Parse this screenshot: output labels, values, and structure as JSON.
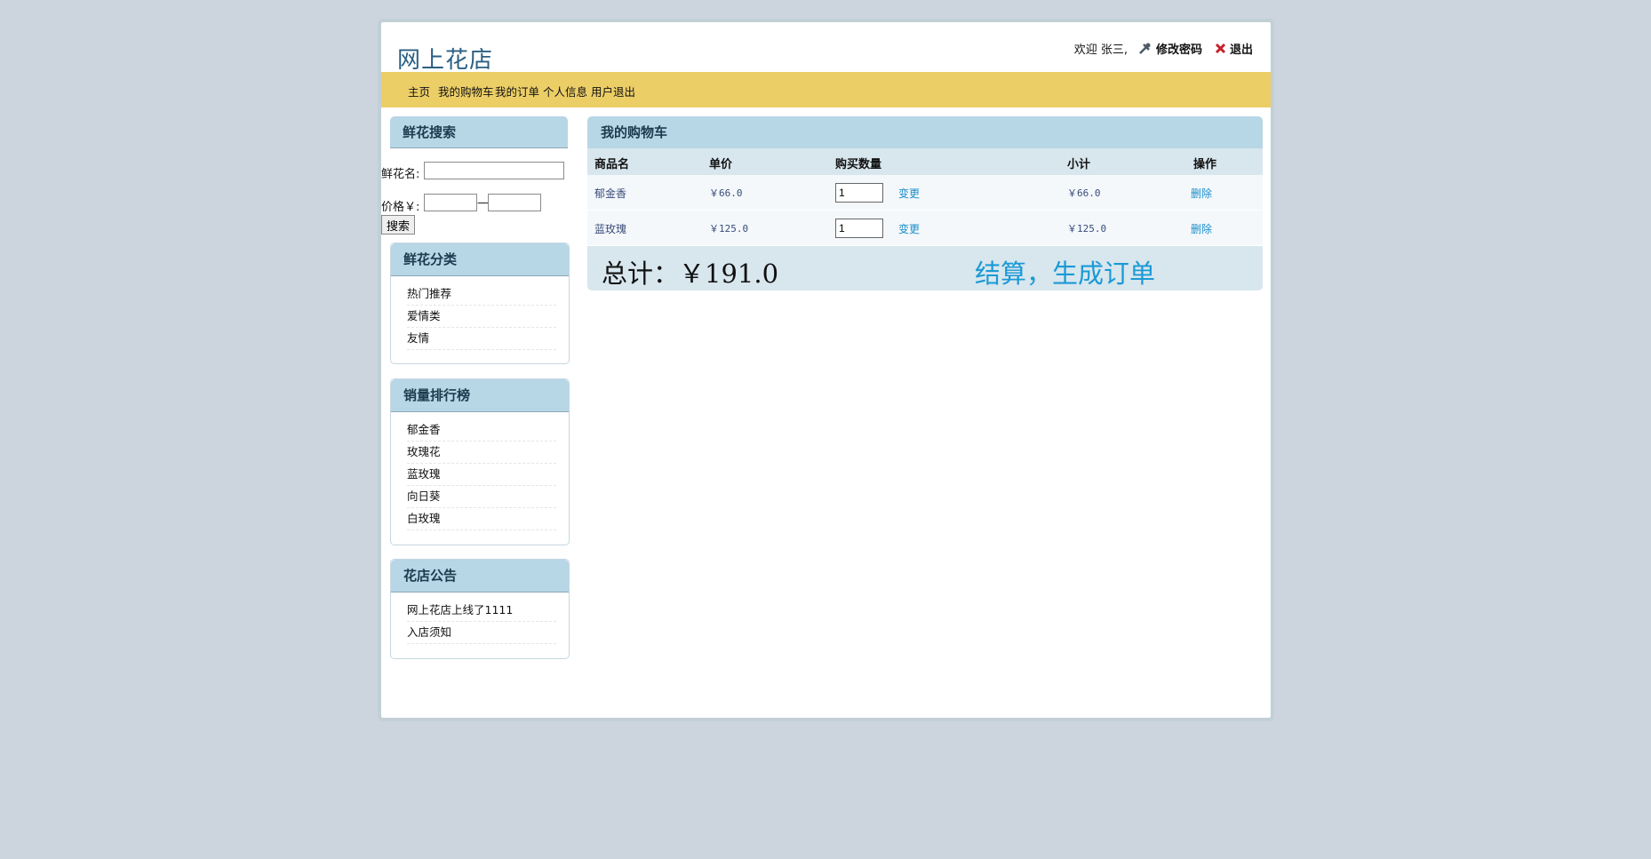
{
  "site": {
    "title": "网上花店"
  },
  "header": {
    "welcome": "欢迎 张三,",
    "change_password": "修改密码",
    "logout": "退出"
  },
  "nav": [
    "主页",
    "我的购物车",
    "我的订单",
    "个人信息",
    "用户退出"
  ],
  "search": {
    "title": "鲜花搜索",
    "name_label": "鲜花名:",
    "price_label": "价格￥:",
    "range_sep": "—",
    "button": "搜索",
    "name_value": "",
    "price_min_value": "",
    "price_max_value": ""
  },
  "categories": {
    "title": "鲜花分类",
    "items": [
      "热门推荐",
      "爱情类",
      "友情"
    ]
  },
  "ranking": {
    "title": "销量排行榜",
    "items": [
      "郁金香",
      "玫瑰花",
      "蓝玫瑰",
      "向日葵",
      "白玫瑰"
    ]
  },
  "notices": {
    "title": "花店公告",
    "items": [
      "网上花店上线了1111",
      "入店须知"
    ]
  },
  "cart": {
    "title": "我的购物车",
    "columns": [
      "商品名",
      "单价",
      "购买数量",
      "小计",
      "操作"
    ],
    "rows": [
      {
        "name": "郁金香",
        "price": "￥66.0",
        "qty": "1",
        "change": "变更",
        "subtotal": "￥66.0",
        "action": "删除"
      },
      {
        "name": "蓝玫瑰",
        "price": "￥125.0",
        "qty": "1",
        "change": "变更",
        "subtotal": "￥125.0",
        "action": "删除"
      }
    ],
    "total": "总计：￥191.0",
    "checkout": "结算，生成订单"
  },
  "colors": {
    "nav_bar": "#ecce67",
    "panel_header": "#b7d6e6",
    "link_blue": "#1a8ecb",
    "title_blue": "#2b5f83"
  }
}
